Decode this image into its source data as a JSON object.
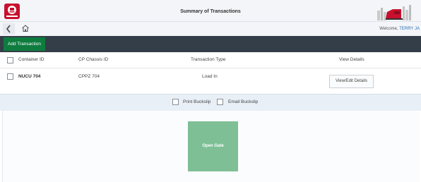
{
  "header": {
    "title": "Summary of Transactions"
  },
  "nav": {
    "welcome_prefix": "Welcome, ",
    "user": "TERRY JA"
  },
  "toolbar": {
    "add_label": "Add Transaction"
  },
  "table": {
    "columns": [
      "Container ID",
      "CP Chassis ID",
      "Transaction Type",
      "View Details"
    ],
    "rows": [
      {
        "container_id": "NUCU 704",
        "chassis_id": "CPPZ 704",
        "transaction_type": "Load In",
        "action": "View/Edit Details"
      }
    ]
  },
  "buckslip": {
    "print_label": "Print Buckslip",
    "email_label": "Email Buckslip"
  },
  "gate": {
    "label": "Open Gate"
  },
  "colors": {
    "toolbar": "#343e48",
    "add_button": "#0e7c3f",
    "gate_button": "#7fbf96",
    "accent": "#2a6fb6"
  }
}
